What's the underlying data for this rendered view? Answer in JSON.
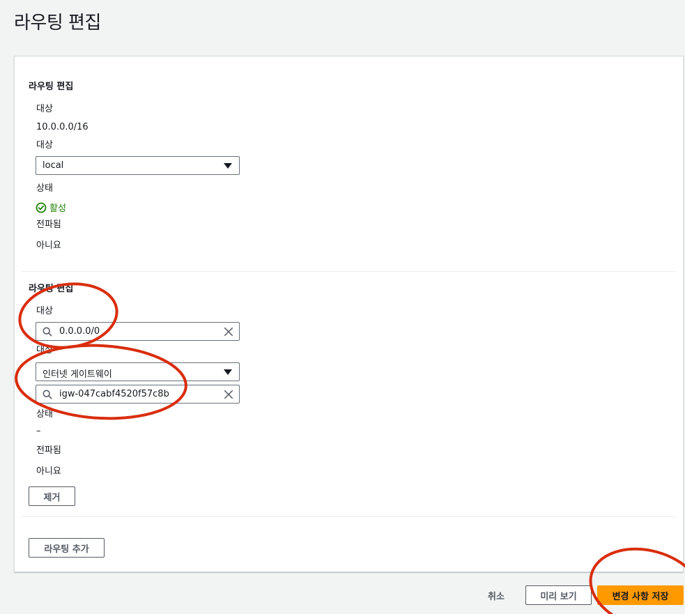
{
  "page": {
    "title": "라우팅 편집"
  },
  "route1": {
    "heading": "라우팅 편집",
    "destination_label": "대상",
    "destination_value": "10.0.0.0/16",
    "target_label": "대상",
    "target_select": "local",
    "status_label": "상태",
    "status_value": "활성",
    "propagated_label": "전파됨",
    "propagated_value": "아니요"
  },
  "route2": {
    "heading": "라우팅 편집",
    "destination_label": "대상",
    "destination_value": "0.0.0.0/0",
    "target_label": "대상",
    "target_select": "인터넷 게이트웨이",
    "target_search_value": "igw-047cabf4520f57c8b",
    "status_label": "상태",
    "status_value": "–",
    "propagated_label": "전파됨",
    "propagated_value": "아니요",
    "remove_button": "제거"
  },
  "add_route_button": "라우팅 추가",
  "footer": {
    "cancel": "취소",
    "preview": "미리 보기",
    "save": "변경 사항 저장"
  },
  "colors": {
    "primary": "#ff9900",
    "success": "#1d8102",
    "annotation": "#d92d0d"
  }
}
